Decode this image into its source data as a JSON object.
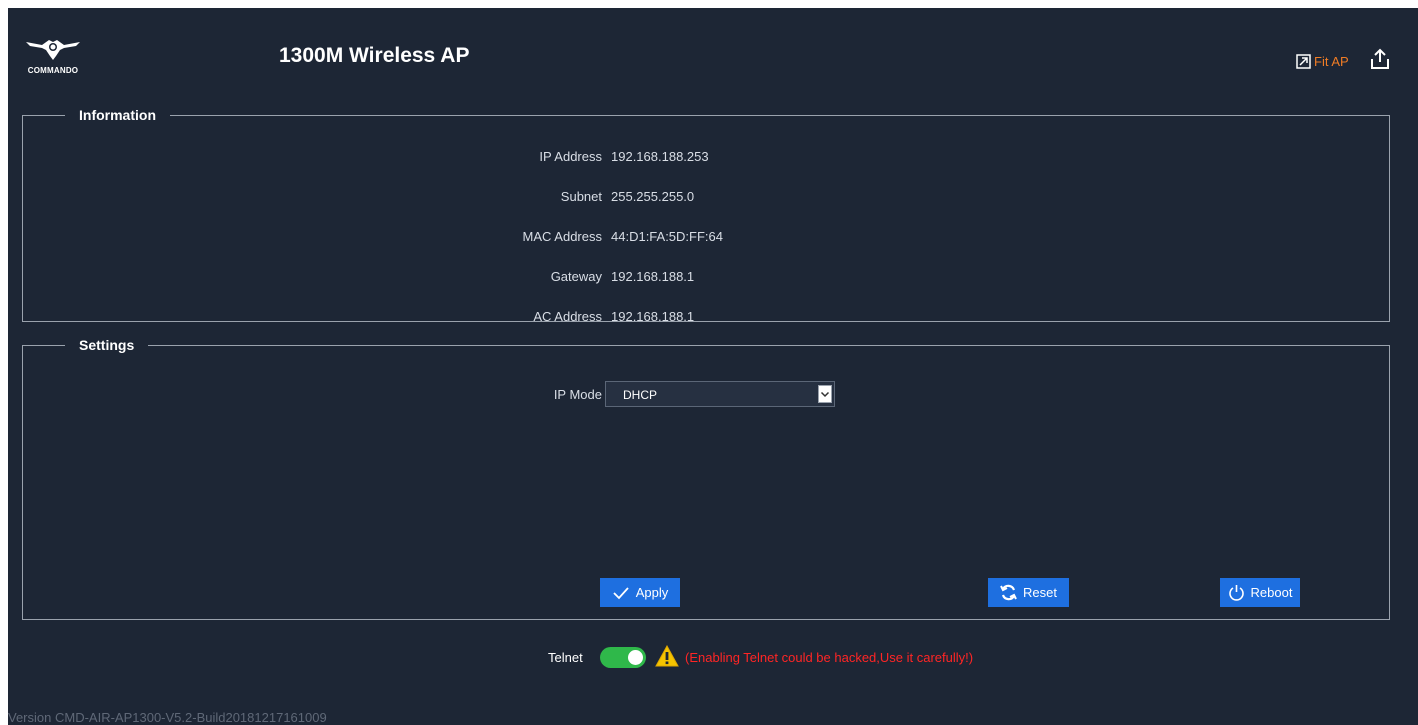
{
  "header": {
    "logo_text": "COMMANDO",
    "title": "1300M Wireless AP",
    "fit_ap_label": "Fit AP",
    "accent_color": "#f07c25"
  },
  "information": {
    "legend": "Information",
    "rows": [
      {
        "label": "IP Address",
        "value": "192.168.188.253"
      },
      {
        "label": "Subnet",
        "value": "255.255.255.0"
      },
      {
        "label": "MAC Address",
        "value": "44:D1:FA:5D:FF:64"
      },
      {
        "label": "Gateway",
        "value": "192.168.188.1"
      },
      {
        "label": "AC Address",
        "value": "192.168.188.1"
      }
    ]
  },
  "settings": {
    "legend": "Settings",
    "ip_mode_label": "IP Mode",
    "ip_mode_value": "DHCP",
    "apply_label": "Apply",
    "reset_label": "Reset",
    "reboot_label": "Reboot",
    "button_color": "#1e6fe0"
  },
  "telnet": {
    "label": "Telnet",
    "enabled": true,
    "warning": "(Enabling Telnet could be hacked,Use it carefully!)",
    "toggle_color": "#2fb84a",
    "warning_color": "#ff2525"
  },
  "footer": {
    "version": "Version CMD-AIR-AP1300-V5.2-Build20181217161009"
  },
  "icons": [
    "commando-logo-icon",
    "fit-ap-icon",
    "export-icon",
    "checkmark-icon",
    "refresh-icon",
    "power-icon",
    "warning-icon",
    "chevron-down-icon"
  ]
}
